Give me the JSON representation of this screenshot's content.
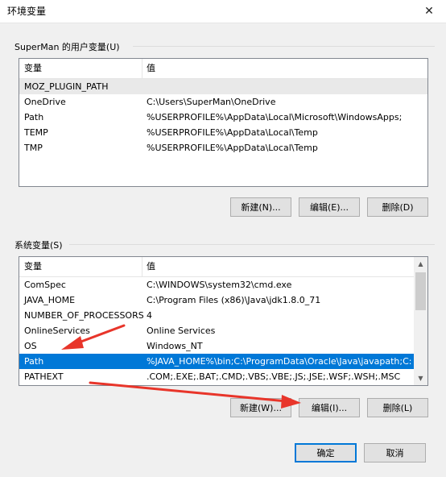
{
  "window": {
    "title": "环境变量",
    "close_icon": "close-icon"
  },
  "user_section": {
    "label": "SuperMan 的用户变量(U)",
    "columns": [
      "变量",
      "值"
    ],
    "rows": [
      {
        "name": "MOZ_PLUGIN_PATH",
        "value": ""
      },
      {
        "name": "OneDrive",
        "value": "C:\\Users\\SuperMan\\OneDrive"
      },
      {
        "name": "Path",
        "value": "%USERPROFILE%\\AppData\\Local\\Microsoft\\WindowsApps;"
      },
      {
        "name": "TEMP",
        "value": "%USERPROFILE%\\AppData\\Local\\Temp"
      },
      {
        "name": "TMP",
        "value": "%USERPROFILE%\\AppData\\Local\\Temp"
      }
    ],
    "buttons": {
      "new": "新建(N)...",
      "edit": "编辑(E)...",
      "delete": "删除(D)"
    }
  },
  "system_section": {
    "label": "系统变量(S)",
    "columns": [
      "变量",
      "值"
    ],
    "rows": [
      {
        "name": "ComSpec",
        "value": "C:\\WINDOWS\\system32\\cmd.exe"
      },
      {
        "name": "JAVA_HOME",
        "value": "C:\\Program Files (x86)\\Java\\jdk1.8.0_71"
      },
      {
        "name": "NUMBER_OF_PROCESSORS",
        "value": "4"
      },
      {
        "name": "OnlineServices",
        "value": "Online Services"
      },
      {
        "name": "OS",
        "value": "Windows_NT"
      },
      {
        "name": "Path",
        "value": "%JAVA_HOME%\\bin;C:\\ProgramData\\Oracle\\Java\\javapath;C:..."
      },
      {
        "name": "PATHEXT",
        "value": ".COM;.EXE;.BAT;.CMD;.VBS;.VBE;.JS;.JSE;.WSF;.WSH;.MSC"
      }
    ],
    "selected_row": "Path",
    "buttons": {
      "new": "新建(W)...",
      "edit": "编辑(I)...",
      "delete": "删除(L)"
    }
  },
  "footer": {
    "ok": "确定",
    "cancel": "取消"
  },
  "colors": {
    "selection": "#0078d7",
    "annotation_arrow": "#e8352a"
  }
}
